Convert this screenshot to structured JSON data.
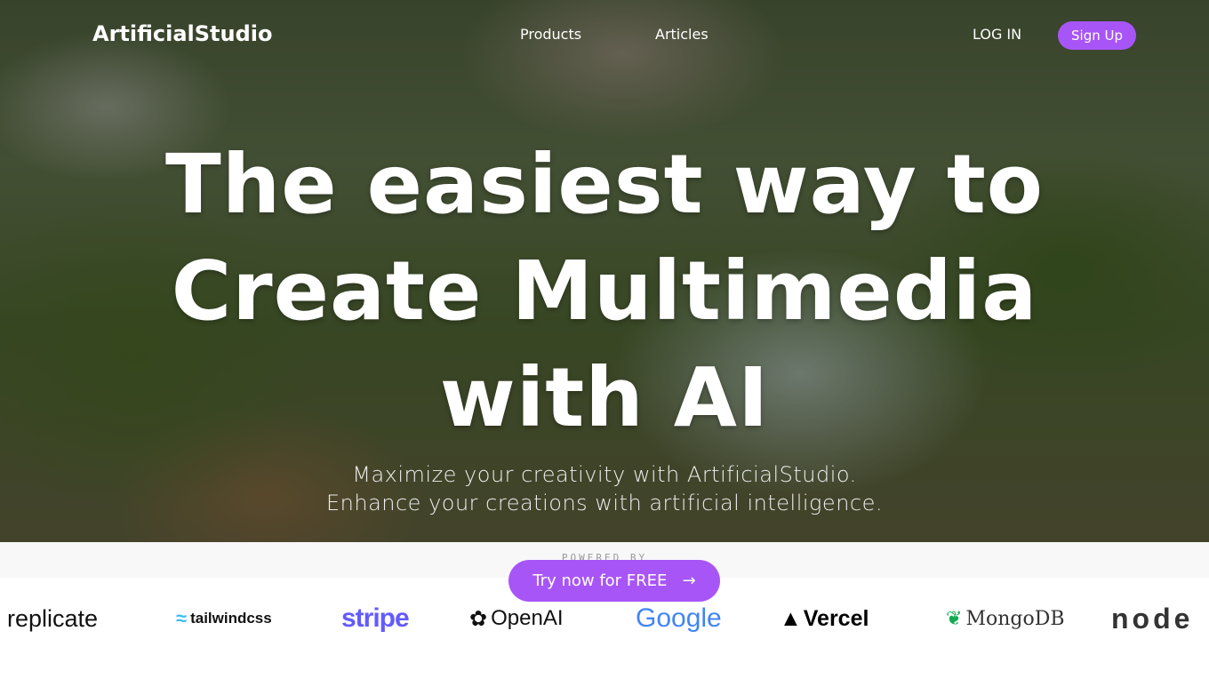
{
  "nav": {
    "brand": "ArtificialStudio",
    "links": [
      "Products",
      "Articles"
    ],
    "login": "LOG IN",
    "signup": "Sign Up"
  },
  "hero": {
    "title_lines": [
      "The easiest way to",
      "Create Multimedia",
      "with AI"
    ],
    "subtitle_lines": [
      "Maximize your creativity with ArtificialStudio.",
      "Enhance your creations with artificial intelligence."
    ]
  },
  "powered_by": "POWERED BY",
  "cta": {
    "label": "Try now for FREE",
    "icon": "arrow-right-icon"
  },
  "logos": [
    "replicate",
    "tailwindcss",
    "stripe",
    "OpenAI",
    "Google",
    "Vercel",
    "MongoDB",
    "node"
  ],
  "colors": {
    "accent": "#a855f7"
  }
}
